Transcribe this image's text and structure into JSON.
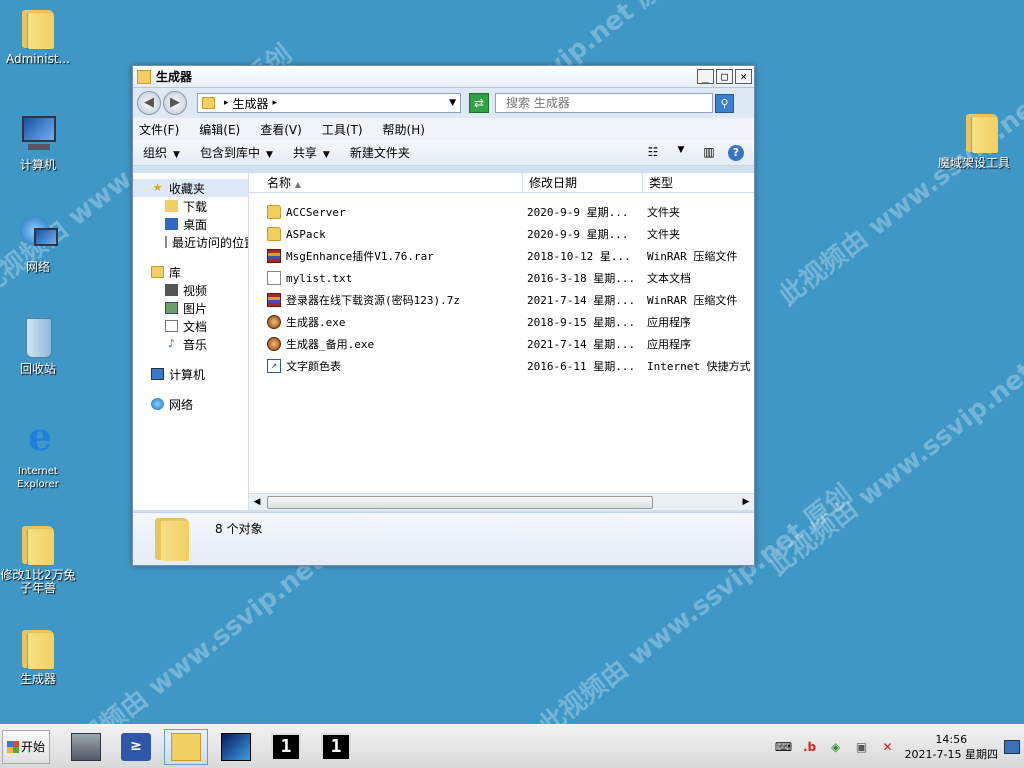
{
  "watermark": {
    "a": "此视频由 www.ssvip.net 原创"
  },
  "desktop": {
    "icons": [
      {
        "label": "Administ..."
      },
      {
        "label": "计算机"
      },
      {
        "label": "网络"
      },
      {
        "label": "回收站"
      },
      {
        "label": "Internet Explorer"
      },
      {
        "label": "修改1比2万兔子年兽"
      },
      {
        "label": "生成器"
      },
      {
        "label": "魔域架设工具"
      }
    ]
  },
  "window": {
    "title": "生成器",
    "buttons": {
      "minimize": "_",
      "maximize": "□",
      "close": "×"
    },
    "address": {
      "path": "生成器"
    },
    "search": {
      "placeholder": "搜索 生成器"
    },
    "menu": [
      "文件(F)",
      "编辑(E)",
      "查看(V)",
      "工具(T)",
      "帮助(H)"
    ],
    "toolbar": {
      "organize": "组织",
      "include": "包含到库中",
      "share": "共享",
      "newfolder": "新建文件夹"
    },
    "nav": {
      "favorites": "收藏夹",
      "fav_items": [
        "下载",
        "桌面",
        "最近访问的位置"
      ],
      "library": "库",
      "lib_items": [
        "视频",
        "图片",
        "文档",
        "音乐"
      ],
      "computer": "计算机",
      "network": "网络"
    },
    "columns": {
      "name": "名称",
      "date": "修改日期",
      "type": "类型"
    },
    "files": [
      {
        "name": "ACCServer",
        "date": "2020-9-9 星期...",
        "type": "文件夹",
        "icon": "folder-icon"
      },
      {
        "name": "ASPack",
        "date": "2020-9-9 星期...",
        "type": "文件夹",
        "icon": "folder-icon"
      },
      {
        "name": "MsgEnhance插件V1.76.rar",
        "date": "2018-10-12 星...",
        "type": "WinRAR 压缩文件",
        "icon": "rar-icon"
      },
      {
        "name": "mylist.txt",
        "date": "2016-3-18 星期...",
        "type": "文本文档",
        "icon": "text-file-icon"
      },
      {
        "name": "登录器在线下载资源(密码123).7z",
        "date": "2021-7-14 星期...",
        "type": "WinRAR 压缩文件",
        "icon": "rar-icon"
      },
      {
        "name": "生成器.exe",
        "date": "2018-9-15 星期...",
        "type": "应用程序",
        "icon": "exe-icon"
      },
      {
        "name": "生成器_备用.exe",
        "date": "2021-7-14 星期...",
        "type": "应用程序",
        "icon": "exe-icon"
      },
      {
        "name": "文字颜色表",
        "date": "2016-6-11 星期...",
        "type": "Internet 快捷方式",
        "icon": "shortcut-icon"
      }
    ],
    "status": {
      "count": "8 个对象"
    }
  },
  "taskbar": {
    "start": "开始",
    "cmd1": "1",
    "cmd2": "1",
    "clock": {
      "time": "14:56",
      "date": "2021-7-15 星期四"
    }
  }
}
